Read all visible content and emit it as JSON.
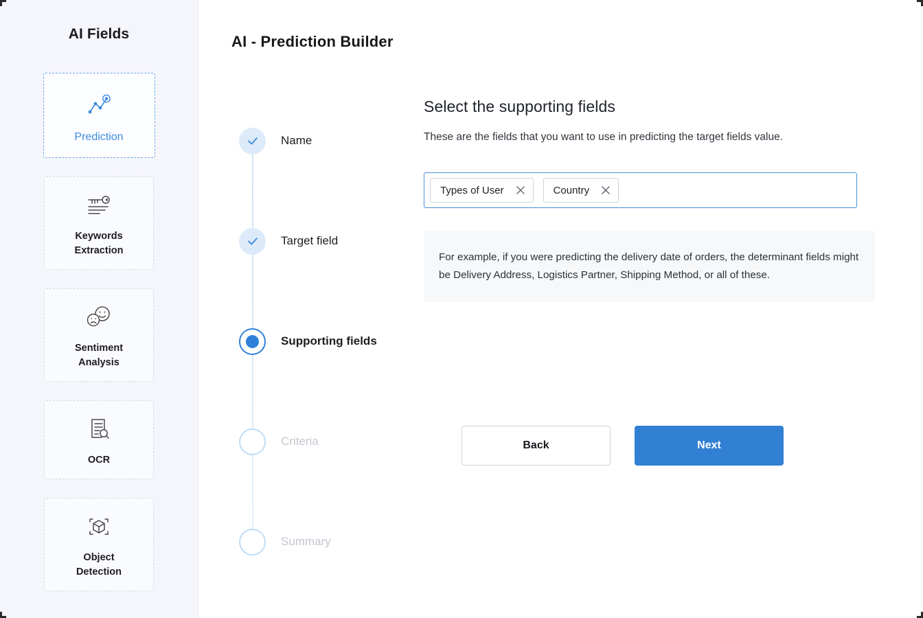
{
  "sidebar": {
    "title": "AI Fields",
    "items": [
      {
        "label": "Prediction",
        "icon": "prediction-line-chart-icon",
        "active": true
      },
      {
        "label": "Keywords\nExtraction",
        "icon": "key-text-icon",
        "active": false
      },
      {
        "label": "Sentiment\nAnalysis",
        "icon": "smiley-faces-icon",
        "active": false
      },
      {
        "label": "OCR",
        "icon": "document-magnifier-icon",
        "active": false
      },
      {
        "label": "Object\nDetection",
        "icon": "cube-scan-icon",
        "active": false
      }
    ]
  },
  "header": {
    "title": "AI - Prediction Builder"
  },
  "stepper": {
    "steps": [
      {
        "label": "Name",
        "state": "done"
      },
      {
        "label": "Target field",
        "state": "done"
      },
      {
        "label": "Supporting fields",
        "state": "current"
      },
      {
        "label": "Criteria",
        "state": "todo"
      },
      {
        "label": "Summary",
        "state": "todo"
      }
    ]
  },
  "panel": {
    "heading": "Select the supporting fields",
    "subtitle": "These are the fields that you want to use in predicting the target fields value.",
    "tags": [
      {
        "label": "Types of User"
      },
      {
        "label": "Country"
      }
    ],
    "input_placeholder": "",
    "info": "For example, if you were predicting the delivery date of orders, the determinant fields might be Delivery Address, Logistics Partner, Shipping Method, or all of these."
  },
  "actions": {
    "back_label": "Back",
    "next_label": "Next"
  },
  "colors": {
    "accent": "#3180d3",
    "accent_light": "#dceafa",
    "sidebar_bg": "#f5f6fb",
    "muted_text": "#c3c6cf",
    "info_bg": "#f7f8f9"
  }
}
